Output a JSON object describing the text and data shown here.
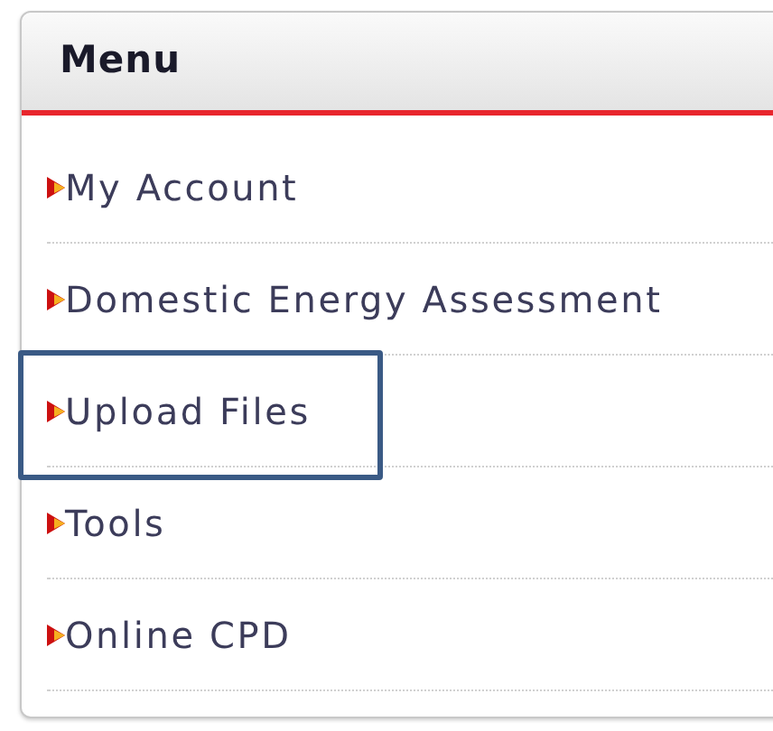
{
  "menu": {
    "title": "Menu",
    "items": [
      {
        "label": "My Account",
        "highlighted": false
      },
      {
        "label": "Domestic Energy Assessment",
        "highlighted": false
      },
      {
        "label": "Upload Files",
        "highlighted": true
      },
      {
        "label": "Tools",
        "highlighted": false
      },
      {
        "label": "Online CPD",
        "highlighted": false
      }
    ]
  }
}
